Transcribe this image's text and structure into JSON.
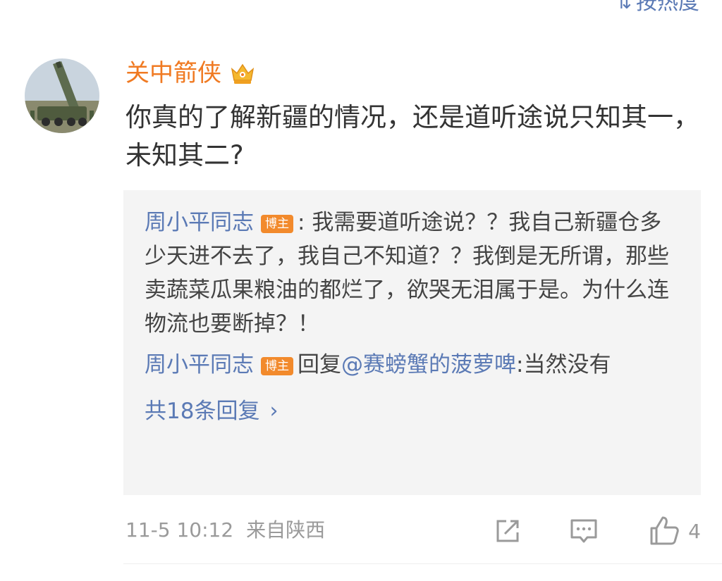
{
  "sort": {
    "label": "按热度"
  },
  "comment": {
    "username": "关中箭侠",
    "text": "你真的了解新疆的情况，还是道听途说只知其一，未知其二?",
    "time": "11-5 10:12",
    "location": "来自陕西",
    "like_count": "4"
  },
  "replies": [
    {
      "author": "周小平同志",
      "badge": "博主",
      "separator": ": ",
      "text": "我需要道听途说？？我自己新疆仓多少天进不去了，我自己不知道？？我倒是无所谓，那些卖蔬菜瓜果粮油的都烂了，欲哭无泪属于是。为什么连物流也要断掉？！"
    },
    {
      "author": "周小平同志",
      "badge": "博主",
      "reply_prefix": "回复",
      "mention": "@赛螃蟹的菠萝啤",
      "separator": ":",
      "text": "当然没有"
    }
  ],
  "more_replies": {
    "label": "共18条回复"
  },
  "colors": {
    "username": "#f07a22",
    "link": "#5b7ab5",
    "badge": "#f28a2c",
    "reply_bg": "#f4f4f4",
    "meta": "#9a9a9a"
  }
}
